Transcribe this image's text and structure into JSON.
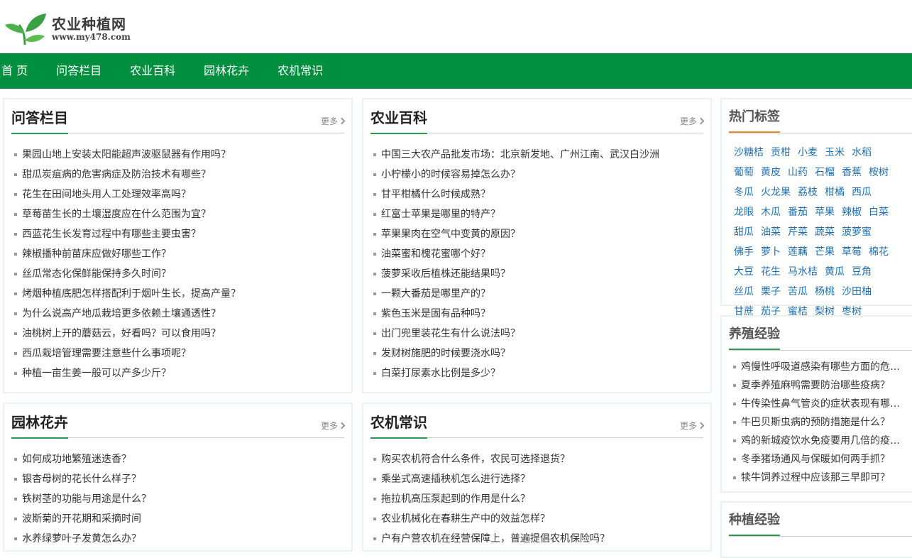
{
  "site": {
    "title": "农业种植网",
    "url": "www.my478.com"
  },
  "nav": [
    "首 页",
    "问答栏目",
    "农业百科",
    "园林花卉",
    "农机常识"
  ],
  "more_label": "更多",
  "sections": {
    "qa": {
      "title": "问答栏目",
      "items": [
        "果园山地上安装太阳能超声波驱鼠器有作用吗？",
        "甜瓜炭疽病的危害病症及防治技术有哪些？",
        "花生在田间地头用人工处理效率高吗？",
        "草莓苗生长的土壤湿度应在什么范围为宜？",
        "西蓝花生长发育过程中有哪些主要虫害？",
        "辣椒播种前苗床应做好哪些工作？",
        "丝瓜常态化保鲜能保持多久时间？",
        "烤烟种植底肥怎样搭配利于烟叶生长，提高产量？",
        "为什么说高产地瓜栽培更多依赖土壤通透性？",
        "油桃树上开的蘑菇云，好看吗？可以食用吗？",
        "西瓜栽培管理需要注意些什么事项呢？",
        "种植一亩生姜一般可以产多少斤？"
      ]
    },
    "baike": {
      "title": "农业百科",
      "items": [
        "中国三大农产品批发市场：北京新发地、广州江南、武汉白沙洲",
        "小柠檬小的时候容易掉怎么办？",
        "甘平柑橘什么时候成熟？",
        "红富士苹果是哪里的特产？",
        "苹果果肉在空气中变黄的原因？",
        "油菜蜜和槐花蜜哪个好？",
        "菠萝采收后植株还能结果吗？",
        "一颗大番茄是哪里产的？",
        "紫色玉米是固有品种吗？",
        "出门兜里装花生有什么说法吗？",
        "发财树施肥的时候要浇水吗？",
        "白菜打尿素水比例是多少？"
      ]
    },
    "garden": {
      "title": "园林花卉",
      "items": [
        "如何成功地繁殖迷迭香？",
        "银杏母树的花长什么样子？",
        "铁树茎的功能与用途是什么？",
        "波斯菊的开花期和采摘时间",
        "水养绿萝叶子发黄怎么办？"
      ]
    },
    "machine": {
      "title": "农机常识",
      "items": [
        "购买农机符合什么条件，农民可选择退货？",
        "乘坐式高速插秧机怎么进行选择？",
        "拖拉机高压泵起到的作用是什么？",
        "农业机械化在春耕生产中的效益怎样？",
        "户有户营农机在经营保障上，普遍提倡农机保险吗？"
      ]
    }
  },
  "sidebar": {
    "tags_title": "热门标签",
    "tags": [
      "沙糖桔",
      "贡柑",
      "小麦",
      "玉米",
      "水稻",
      "葡萄",
      "黄皮",
      "山药",
      "石榴",
      "香蕉",
      "桉树",
      "冬瓜",
      "火龙果",
      "荔枝",
      "柑橘",
      "西瓜",
      "龙眼",
      "木瓜",
      "番茄",
      "苹果",
      "辣椒",
      "白菜",
      "甜瓜",
      "油菜",
      "芹菜",
      "蔬菜",
      "菠萝蜜",
      "佛手",
      "萝卜",
      "莲藕",
      "芒果",
      "草莓",
      "棉花",
      "大豆",
      "花生",
      "马水桔",
      "黄瓜",
      "豆角",
      "丝瓜",
      "栗子",
      "苦瓜",
      "杨桃",
      "沙田柚",
      "甘蔗",
      "茄子",
      "蜜桔",
      "梨树",
      "枣树"
    ],
    "breeding_title": "养殖经验",
    "breeding": [
      "鸡慢性呼吸道感染有哪些方面的危害？",
      "夏季养殖麻鸭需要防治哪些疫病？",
      "牛传染性鼻气管炎的症状表现有哪些？",
      "牛巴贝斯虫病的预防措施是什么？",
      "鸡的新城疫饮水免疫要用几倍的疫苗量？",
      "冬季猪场通风与保暖如何两手抓？",
      "犊牛饲养过程中应该那三早即可？"
    ],
    "planting_title": "种植经验"
  },
  "colors": {
    "nav_bg": "#008f3e",
    "accent_green": "#2b9a4a",
    "accent_orange": "#ef8a2b",
    "tag_blue": "#1f6fb0"
  }
}
